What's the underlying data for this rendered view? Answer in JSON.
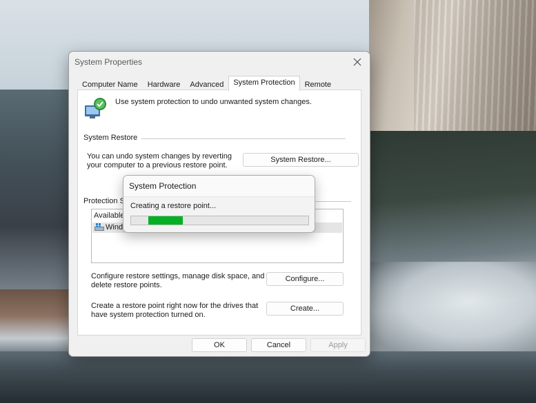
{
  "dialog": {
    "title": "System Properties",
    "tabs": [
      "Computer Name",
      "Hardware",
      "Advanced",
      "System Protection",
      "Remote"
    ],
    "active_tab": "System Protection",
    "intro": "Use system protection to undo unwanted system changes.",
    "system_restore": {
      "heading": "System Restore",
      "description_line1": "You can undo system changes by reverting",
      "description_line2": "your computer to a previous restore point.",
      "button": "System Restore..."
    },
    "protection_settings": {
      "heading": "Protection S",
      "list_header": "Available",
      "drive_label": "Windo"
    },
    "configure": {
      "line1": "Configure restore settings, manage disk space, and",
      "line2": "delete restore points.",
      "button": "Configure..."
    },
    "create": {
      "line1": "Create a restore point right now for the drives that",
      "line2": "have system protection turned on.",
      "button": "Create..."
    },
    "footer": {
      "ok": "OK",
      "cancel": "Cancel",
      "apply": "Apply"
    }
  },
  "popup": {
    "title": "System Protection",
    "message": "Creating a restore point...",
    "progress_state": "indeterminate",
    "progress_color": "#06b025"
  },
  "icons": {
    "close": "close-icon",
    "shield": "system-protection-icon",
    "drive": "drive-icon"
  }
}
